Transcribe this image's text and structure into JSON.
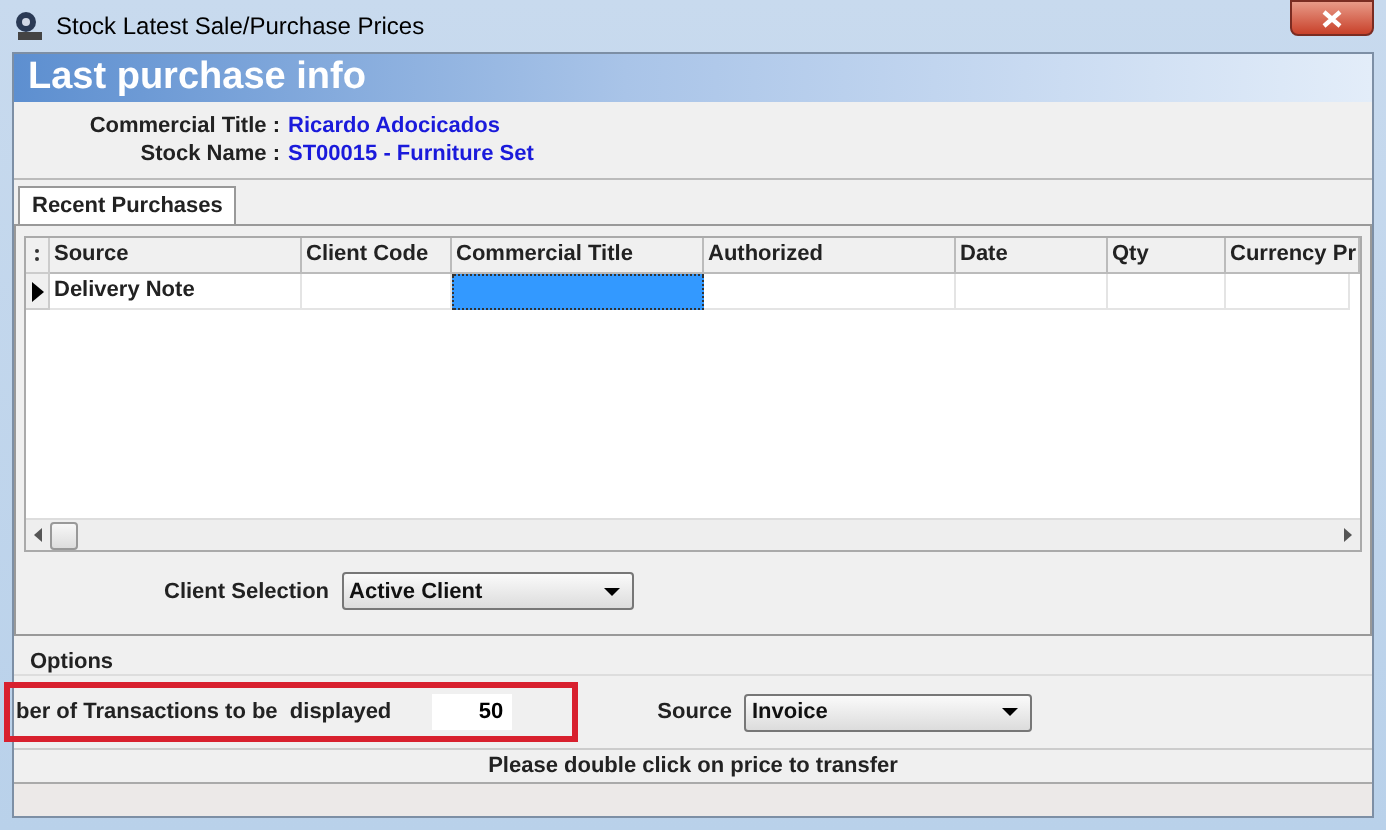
{
  "window": {
    "title": "Stock Latest Sale/Purchase Prices"
  },
  "header": {
    "title": "Last purchase info"
  },
  "info": [
    {
      "label": "Commercial Title :",
      "value": "Ricardo Adocicados"
    },
    {
      "label": "Stock Name :",
      "value": "ST00015 - Furniture Set"
    }
  ],
  "tabs": [
    {
      "label": "Recent Purchases",
      "selected": true
    }
  ],
  "table": {
    "columns": [
      "Source",
      "Client Code",
      "Commercial Title",
      "Authorized",
      "Date",
      "Qty",
      "Currency Pr"
    ],
    "rows": [
      {
        "current": true,
        "cells": [
          {
            "text": "Delivery Note",
            "selected": false
          },
          {
            "selected": false
          },
          {
            "selected": true
          },
          {
            "selected": false
          },
          {
            "selected": false
          },
          {
            "selected": false
          },
          {
            "selected": false
          }
        ]
      }
    ]
  },
  "client_selection": {
    "label": "Client Selection",
    "value": "Active Client"
  },
  "options": {
    "title": "Options",
    "transactions_label": "ber of Transactions to be  displayed",
    "transactions_value": "50",
    "source_label": "Source",
    "source_value": "Invoice"
  },
  "status_bar": "Please double click on price to transfer"
}
